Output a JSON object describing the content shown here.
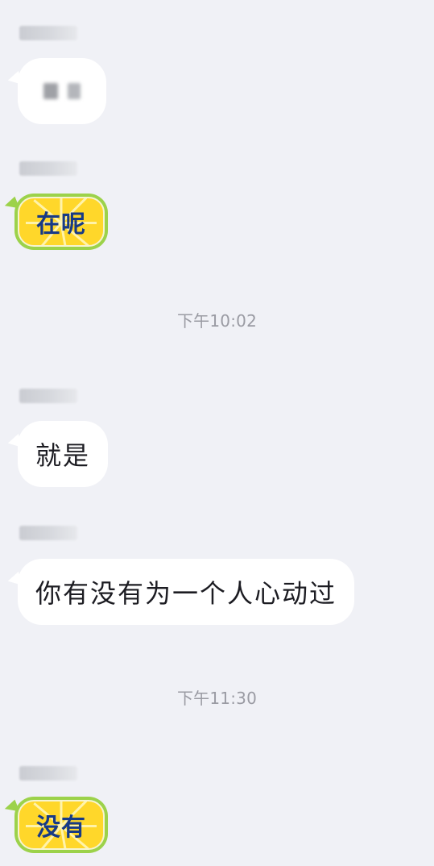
{
  "messages": [
    {
      "kind": "blurred",
      "text": ""
    },
    {
      "kind": "sticker",
      "text": "在呢"
    },
    {
      "kind": "text",
      "text": "就是"
    },
    {
      "kind": "text",
      "text": "你有没有为一个人心动过"
    },
    {
      "kind": "sticker",
      "text": "没有"
    }
  ],
  "timestamps": [
    "下午10:02",
    "下午11:30"
  ],
  "colors": {
    "background": "#f0f1f6",
    "bubble": "#ffffff",
    "sticker_rind": "#9cd24a",
    "sticker_fill": "#ffd72a",
    "sticker_text": "#173a86",
    "timestamp_text": "#9a9ba3"
  }
}
